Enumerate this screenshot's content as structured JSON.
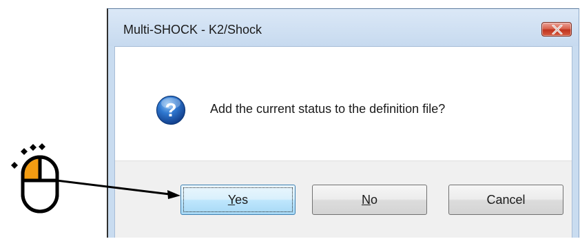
{
  "dialog": {
    "title": "Multi-SHOCK - K2/Shock",
    "message": "Add the current status to the definition file?",
    "icon": "question-icon"
  },
  "buttons": {
    "yes": {
      "mnemonic": "Y",
      "rest": "es"
    },
    "no": {
      "mnemonic": "N",
      "rest": "o"
    },
    "cancel": {
      "label": "Cancel"
    }
  },
  "annotation": {
    "icon": "mouse-left-click-icon",
    "highlight_color": "#f39c12",
    "target": "yes-button"
  },
  "colors": {
    "close_button": "#c7402b",
    "title_bar": "#c9dcf0",
    "button_bar": "#f0f0f0"
  }
}
